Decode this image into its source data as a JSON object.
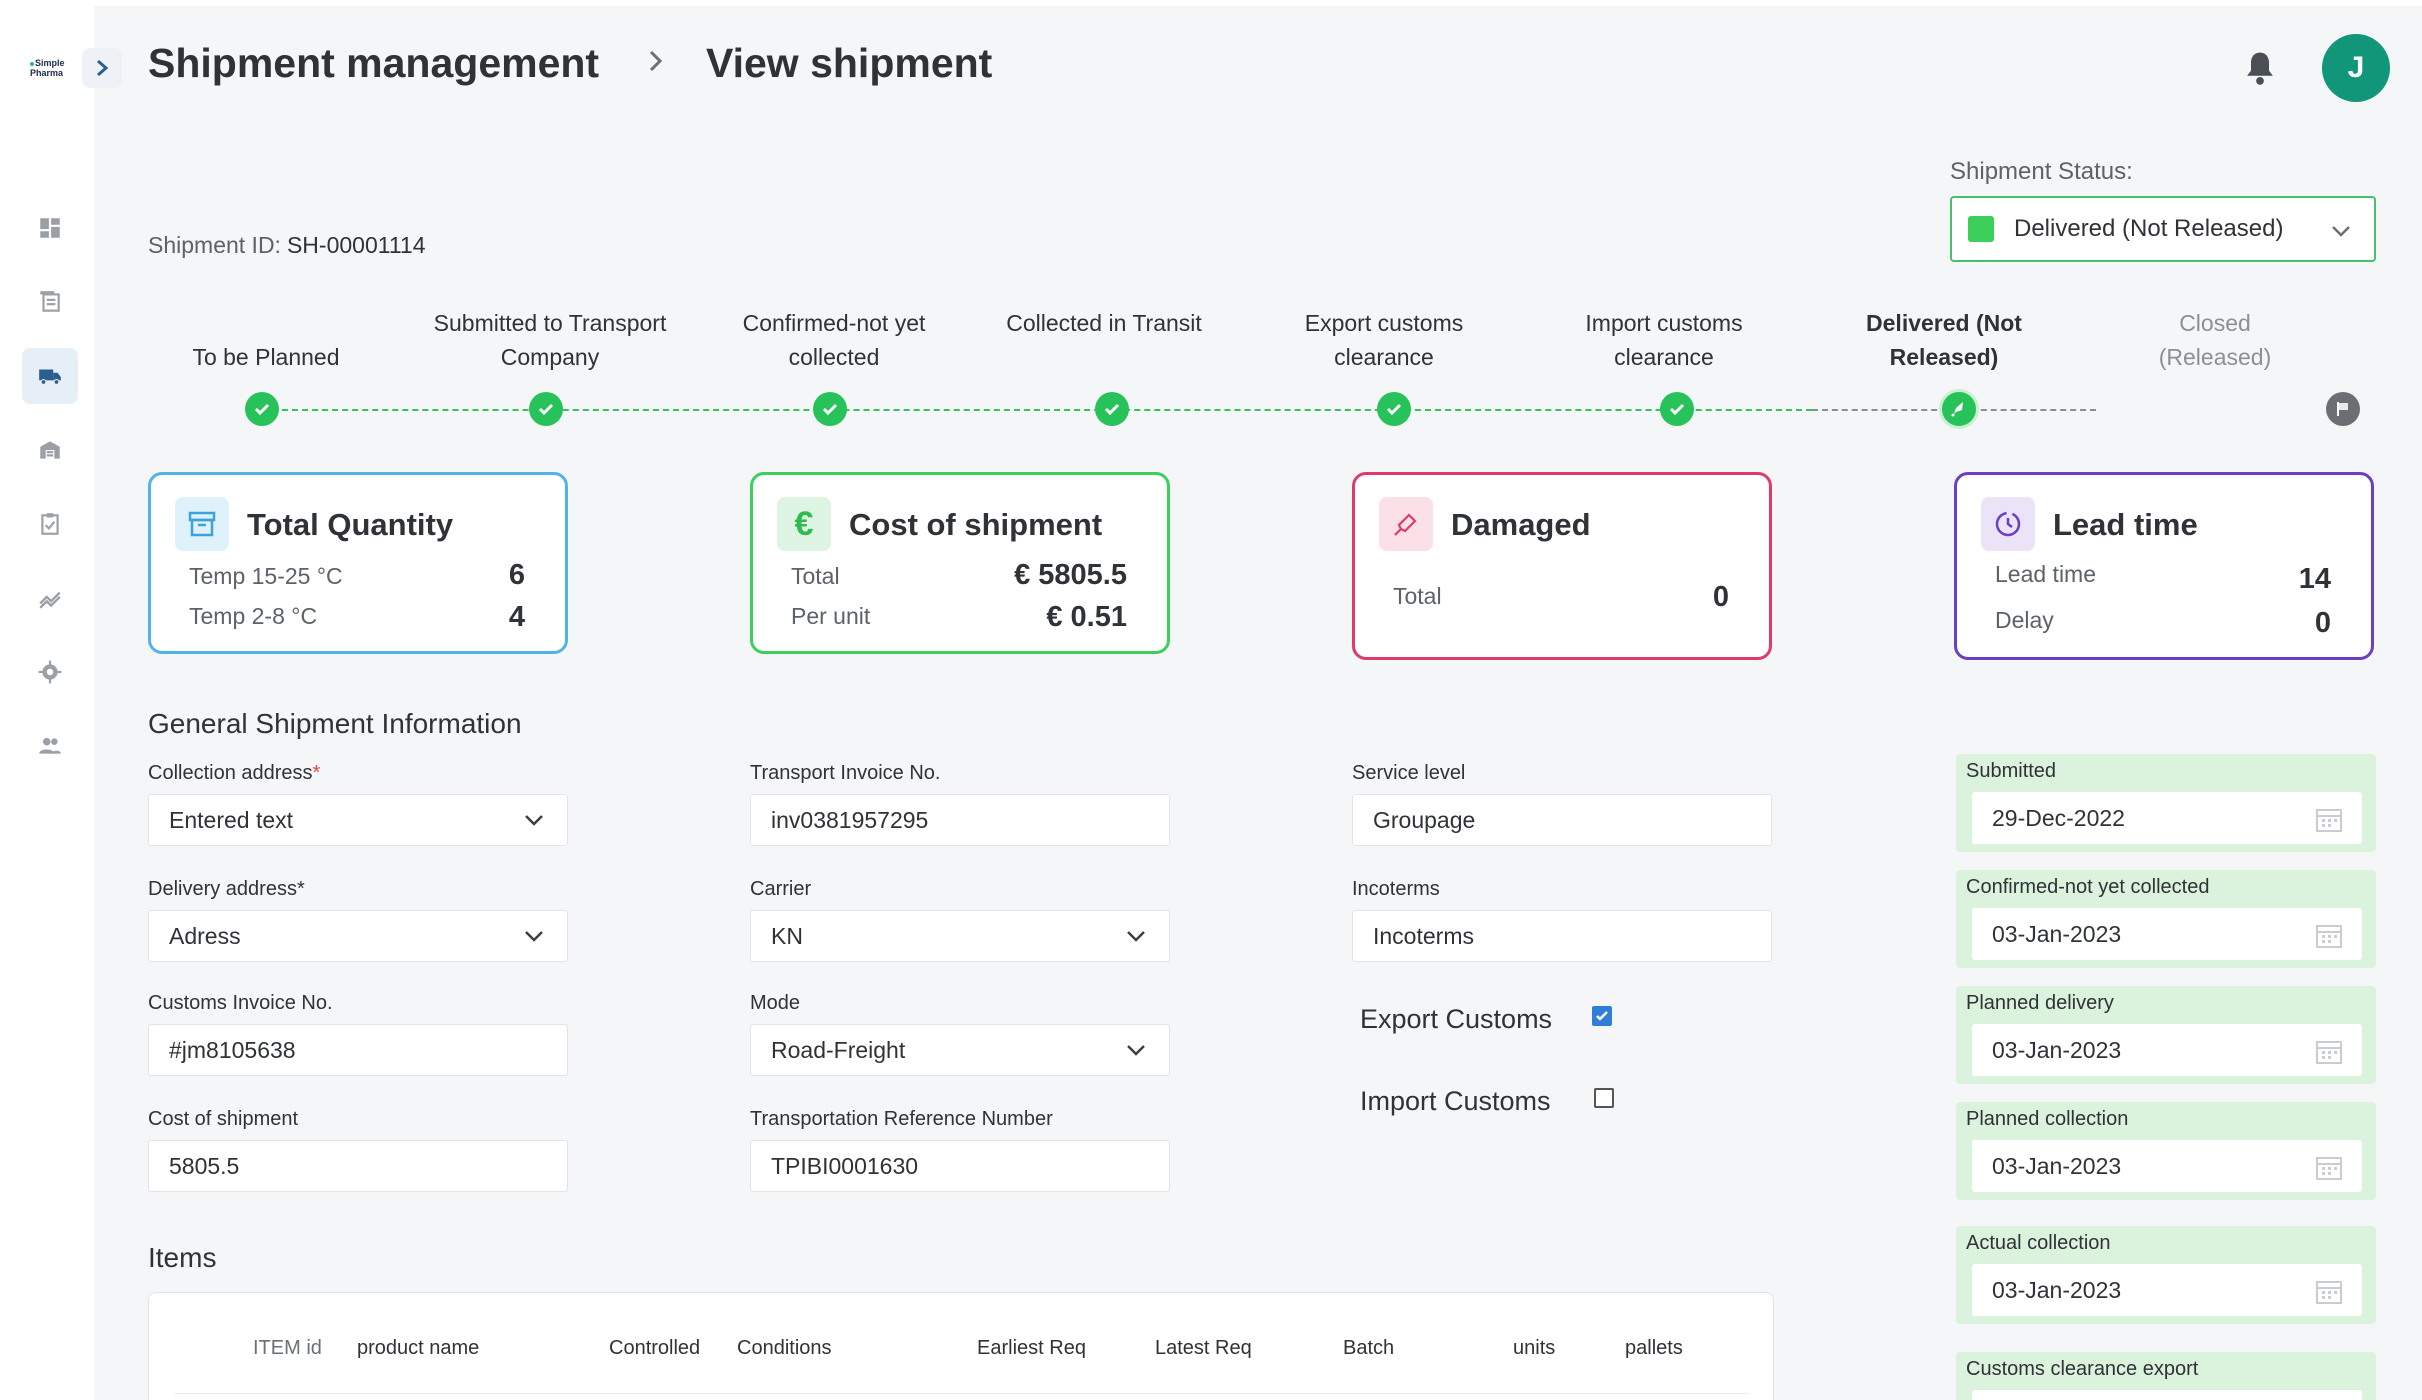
{
  "sidebar": {
    "logo_text": "Simple Pharma",
    "items": [
      {
        "name": "dashboard",
        "icon": "dashboard-icon"
      },
      {
        "name": "documents",
        "icon": "documents-icon"
      },
      {
        "name": "shipments",
        "icon": "truck-icon",
        "active": true
      },
      {
        "name": "warehouse",
        "icon": "warehouse-icon"
      },
      {
        "name": "tasks",
        "icon": "clipboard-check-icon"
      },
      {
        "name": "analytics",
        "icon": "trending-icon"
      },
      {
        "name": "settings",
        "icon": "gear-icon"
      },
      {
        "name": "users",
        "icon": "users-icon"
      }
    ]
  },
  "header": {
    "breadcrumb": [
      "Shipment management",
      "View shipment"
    ],
    "avatar_initial": "J"
  },
  "shipment": {
    "id_label": "Shipment ID:",
    "id_value": "SH-00001114",
    "status_label": "Shipment Status:",
    "status_value": "Delivered (Not Released)",
    "status_color": "#3ccf5a"
  },
  "stepper": [
    {
      "label": "To be Planned",
      "state": "done"
    },
    {
      "label": "Submitted to Transport Company",
      "state": "done"
    },
    {
      "label": "Confirmed-not yet collected",
      "state": "done"
    },
    {
      "label": "Collected in Transit",
      "state": "done"
    },
    {
      "label": "Export customs clearance",
      "state": "done"
    },
    {
      "label": "Import customs clearance",
      "state": "done"
    },
    {
      "label": "Delivered (Not Released)",
      "state": "current"
    },
    {
      "label": "Closed (Released)",
      "state": "pending"
    }
  ],
  "cards": {
    "quantity": {
      "title": "Total Quantity",
      "rows": [
        {
          "label": "Temp 15-25 °C",
          "value": "6"
        },
        {
          "label": "Temp 2-8 °C",
          "value": "4"
        }
      ],
      "color": "#52b4e6"
    },
    "cost": {
      "title": "Cost of shipment",
      "rows": [
        {
          "label": "Total",
          "value": "€ 5805.5"
        },
        {
          "label": "Per unit",
          "value": "€ 0.51"
        }
      ],
      "color": "#3ccf5a"
    },
    "damaged": {
      "title": "Damaged",
      "rows": [
        {
          "label": "Total",
          "value": "0"
        }
      ],
      "color": "#e03a6b"
    },
    "lead": {
      "title": "Lead time",
      "rows": [
        {
          "label": "Lead time",
          "value": "14"
        },
        {
          "label": "Delay",
          "value": "0"
        }
      ],
      "color": "#6a3fc1"
    }
  },
  "general": {
    "title": "General Shipment Information",
    "collection_address": {
      "label": "Collection address",
      "required_mark": "*",
      "value": "Entered text"
    },
    "delivery_address": {
      "label": "Delivery address*",
      "value": "Adress"
    },
    "customs_invoice": {
      "label": "Customs Invoice No.",
      "value": "#jm8105638"
    },
    "cost_of_shipment": {
      "label": "Cost of shipment",
      "value": "5805.5"
    },
    "transport_invoice": {
      "label": "Transport Invoice No.",
      "value": "inv0381957295"
    },
    "carrier": {
      "label": "Carrier",
      "value": "KN"
    },
    "mode": {
      "label": "Mode",
      "value": "Road-Freight"
    },
    "transport_ref": {
      "label": "Transportation Reference Number",
      "value": "TPIBI0001630"
    },
    "service_level": {
      "label": "Service level",
      "value": "Groupage"
    },
    "incoterms": {
      "label": "Incoterms",
      "value": "Incoterms"
    },
    "export_customs": {
      "label": "Export Customs",
      "checked": true
    },
    "import_customs": {
      "label": "Import Customs",
      "checked": false
    }
  },
  "dates": [
    {
      "label": "Submitted",
      "value": "29-Dec-2022"
    },
    {
      "label": "Confirmed-not yet collected",
      "value": "03-Jan-2023"
    },
    {
      "label": "Planned delivery",
      "value": "03-Jan-2023"
    },
    {
      "label": "Planned collection",
      "value": "03-Jan-2023"
    },
    {
      "label": "Actual collection",
      "value": "03-Jan-2023"
    },
    {
      "label": "Customs clearance export",
      "value": ""
    }
  ],
  "items": {
    "title": "Items",
    "columns": [
      "ITEM id",
      "product name",
      "Controlled",
      "Conditions",
      "Earliest Req",
      "Latest Req",
      "Batch",
      "units",
      "pallets"
    ]
  }
}
